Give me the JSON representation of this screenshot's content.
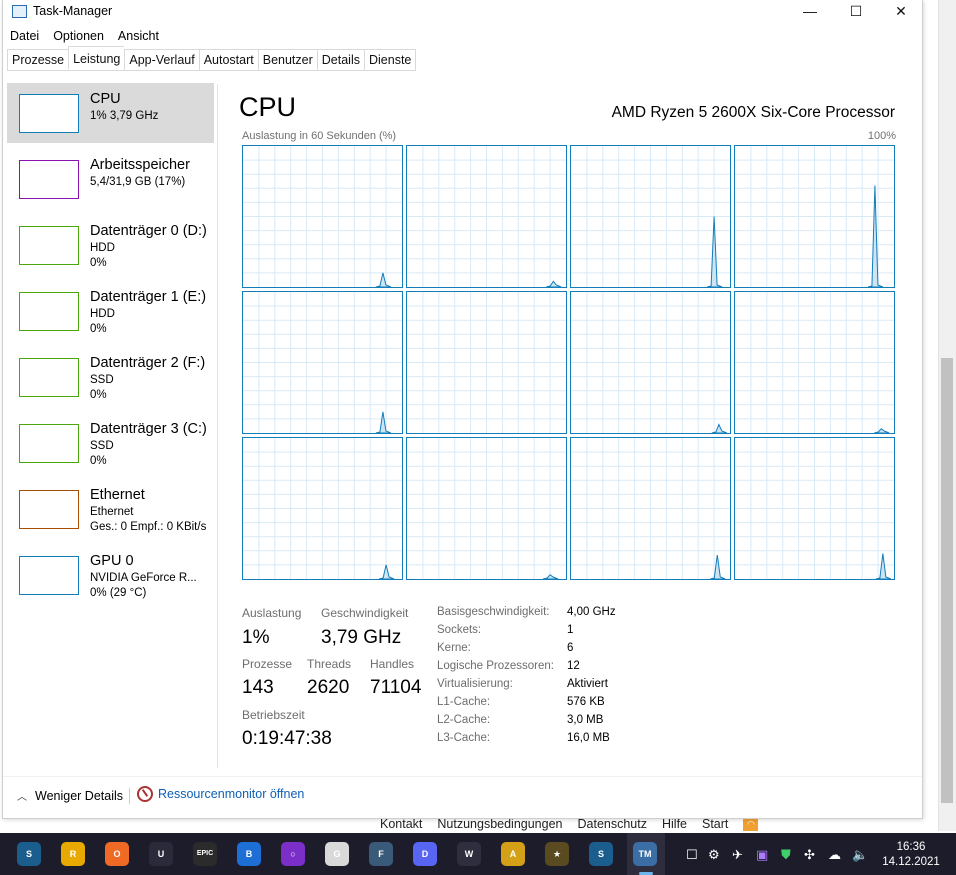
{
  "window": {
    "title": "Task-Manager",
    "minimize": "—",
    "maximize": "☐",
    "close": "✕"
  },
  "menu": [
    "Datei",
    "Optionen",
    "Ansicht"
  ],
  "tabs": [
    "Prozesse",
    "Leistung",
    "App-Verlauf",
    "Autostart",
    "Benutzer",
    "Details",
    "Dienste"
  ],
  "active_tab": "Leistung",
  "sidebar": [
    {
      "name": "CPU",
      "sub1": "1% 3,79 GHz",
      "sub2": "",
      "color": "#117dbb",
      "active": true
    },
    {
      "name": "Arbeitsspeicher",
      "sub1": "5,4/31,9 GB (17%)",
      "sub2": "",
      "color": "#8b12ae"
    },
    {
      "name": "Datenträger 0 (D:)",
      "sub1": "HDD",
      "sub2": "0%",
      "color": "#4da60c"
    },
    {
      "name": "Datenträger 1 (E:)",
      "sub1": "HDD",
      "sub2": "0%",
      "color": "#4da60c"
    },
    {
      "name": "Datenträger 2 (F:)",
      "sub1": "SSD",
      "sub2": "0%",
      "color": "#4da60c"
    },
    {
      "name": "Datenträger 3 (C:)",
      "sub1": "SSD",
      "sub2": "0%",
      "color": "#4da60c"
    },
    {
      "name": "Ethernet",
      "sub1": "Ethernet",
      "sub2": "Ges.: 0 Empf.: 0 KBit/s",
      "color": "#a74f01"
    },
    {
      "name": "GPU 0",
      "sub1": "NVIDIA GeForce R...",
      "sub2": "0% (29 °C)",
      "color": "#117dbb"
    }
  ],
  "cpu": {
    "title": "CPU",
    "model": "AMD Ryzen 5 2600X Six-Core Processor",
    "graph_label": "Auslastung in 60 Sekunden (%)",
    "graph_max": "100%",
    "line_color": "#117dbb",
    "fill_color": "#cfe4f3",
    "core_spikes": [
      [
        {
          "pos": 0.88,
          "h": 0.1
        }
      ],
      [
        {
          "pos": 0.92,
          "h": 0.04
        }
      ],
      [
        {
          "pos": 0.9,
          "h": 0.5
        }
      ],
      [
        {
          "pos": 0.88,
          "h": 0.72
        }
      ],
      [
        {
          "pos": 0.88,
          "h": 0.15
        }
      ],
      [],
      [
        {
          "pos": 0.93,
          "h": 0.06
        }
      ],
      [
        {
          "pos": 0.92,
          "h": 0.03
        }
      ],
      [
        {
          "pos": 0.9,
          "h": 0.1
        }
      ],
      [
        {
          "pos": 0.9,
          "h": 0.03
        }
      ],
      [
        {
          "pos": 0.92,
          "h": 0.17
        }
      ],
      [
        {
          "pos": 0.93,
          "h": 0.18
        }
      ]
    ]
  },
  "stats": {
    "auslastung_label": "Auslastung",
    "auslastung": "1%",
    "geschwindigkeit_label": "Geschwindigkeit",
    "geschwindigkeit": "3,79 GHz",
    "prozesse_label": "Prozesse",
    "prozesse": "143",
    "threads_label": "Threads",
    "threads": "2620",
    "handles_label": "Handles",
    "handles": "71104",
    "betriebszeit_label": "Betriebszeit",
    "betriebszeit": "0:19:47:38"
  },
  "details": [
    {
      "k": "Basisgeschwindigkeit:",
      "v": "4,00 GHz"
    },
    {
      "k": "Sockets:",
      "v": "1"
    },
    {
      "k": "Kerne:",
      "v": "6"
    },
    {
      "k": "Logische Prozessoren:",
      "v": "12"
    },
    {
      "k": "Virtualisierung:",
      "v": "Aktiviert"
    },
    {
      "k": "L1-Cache:",
      "v": "576 KB"
    },
    {
      "k": "L2-Cache:",
      "v": "3,0 MB"
    },
    {
      "k": "L3-Cache:",
      "v": "16,0 MB"
    }
  ],
  "bottom": {
    "less_details": "Weniger Details",
    "resmon": "Ressourcenmonitor öffnen"
  },
  "footer_links": [
    "Kontakt",
    "Nutzungsbedingungen",
    "Datenschutz",
    "Hilfe",
    "Start"
  ],
  "taskbar": {
    "apps": [
      {
        "name": "steam-icon",
        "color": "#1b5d8c",
        "label": "S"
      },
      {
        "name": "rockstar-icon",
        "color": "#e8a900",
        "label": "R"
      },
      {
        "name": "origin-icon",
        "color": "#f06a25",
        "label": "O"
      },
      {
        "name": "ubisoft-icon",
        "color": "#2a2a3a",
        "label": "U"
      },
      {
        "name": "epic-games-icon",
        "color": "#2b2b2b",
        "label": "EPIC"
      },
      {
        "name": "battlenet-icon",
        "color": "#1d6fd6",
        "label": "B"
      },
      {
        "name": "circle-app-icon",
        "color": "#7b2fc8",
        "label": "○"
      },
      {
        "name": "game-app-icon",
        "color": "#d9d9d9",
        "label": "G"
      },
      {
        "name": "fish-app-icon",
        "color": "#3a5a7a",
        "label": "F"
      },
      {
        "name": "discord-icon",
        "color": "#5865f2",
        "label": "D"
      },
      {
        "name": "wolf-app-icon",
        "color": "#2e2e3e",
        "label": "W"
      },
      {
        "name": "avatar-app-icon",
        "color": "#d4a017",
        "label": "A"
      },
      {
        "name": "star-app-icon",
        "color": "#5a4a20",
        "label": "★"
      },
      {
        "name": "steam-icon-2",
        "color": "#1b5d8c",
        "label": "S"
      },
      {
        "name": "task-manager-icon",
        "color": "#3a6ea5",
        "label": "TM"
      }
    ],
    "time": "16:36",
    "date": "14.12.2021"
  }
}
